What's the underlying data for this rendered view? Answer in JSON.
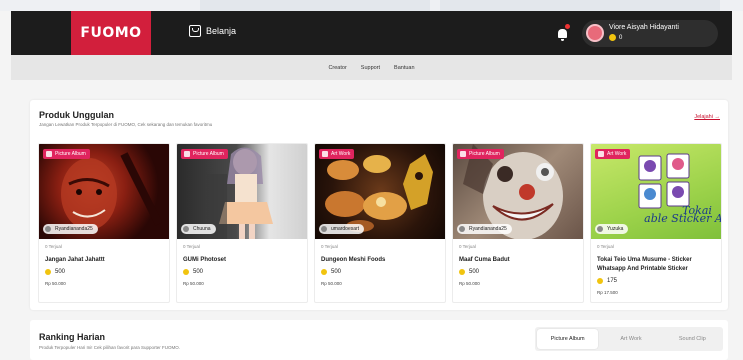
{
  "header": {
    "logo": "FUOMO",
    "shop_label": "Belanja",
    "user_name": "Viore Aisyah Hidayanti",
    "coins": "0"
  },
  "subnav": [
    "Creator",
    "Support",
    "Bantuan"
  ],
  "featured": {
    "title": "Produk Unggulan",
    "subtitle": "Jangan Lewatkan Produk Terpopuler di FUOMO, Cek sekarang dan temukan favoritmu",
    "more_link": "Jelajahi →",
    "products": [
      {
        "badge": "Picture Album",
        "badge_color": "#e0245e",
        "creator": "Ryandiananda25",
        "sold": "0 Terjual",
        "name": "Jangan Jahat Jahattt",
        "points": "500",
        "price": "Rp 50.000"
      },
      {
        "badge": "Picture Album",
        "badge_color": "#e0245e",
        "creator": "Chuuna",
        "sold": "0 Terjual",
        "name": "GUMi Photoset",
        "points": "500",
        "price": "Rp 50.000"
      },
      {
        "badge": "Art Work",
        "badge_color": "#e0245e",
        "creator": "umardoesart",
        "sold": "0 Terjual",
        "name": "Dungeon Meshi Foods",
        "points": "500",
        "price": "Rp 50.000"
      },
      {
        "badge": "Picture Album",
        "badge_color": "#e0245e",
        "creator": "Ryandiananda25",
        "sold": "0 Terjual",
        "name": "Maaf Cuma Badut",
        "points": "500",
        "price": "Rp 50.000"
      },
      {
        "badge": "Art Work",
        "badge_color": "#e0245e",
        "creator": "Yuzuka",
        "sold": "0 Terjual",
        "name": "Tokai Teio Uma Musume - Sticker Whatsapp And Printable Sticker",
        "points": "175",
        "price": "Rp 17.500"
      }
    ]
  },
  "ranking": {
    "title": "Ranking Harian",
    "subtitle": "Produk Terpopuler Hari Ini! Cek pilihan favorit para Supporter FUOMO.",
    "tabs": [
      "Picture Album",
      "Art Work",
      "Sound Clip"
    ],
    "active_tab": "Picture Album"
  },
  "colors": {
    "brand": "#d21f3c",
    "navbar": "#1c1c1c",
    "coin": "#f1c40f"
  }
}
